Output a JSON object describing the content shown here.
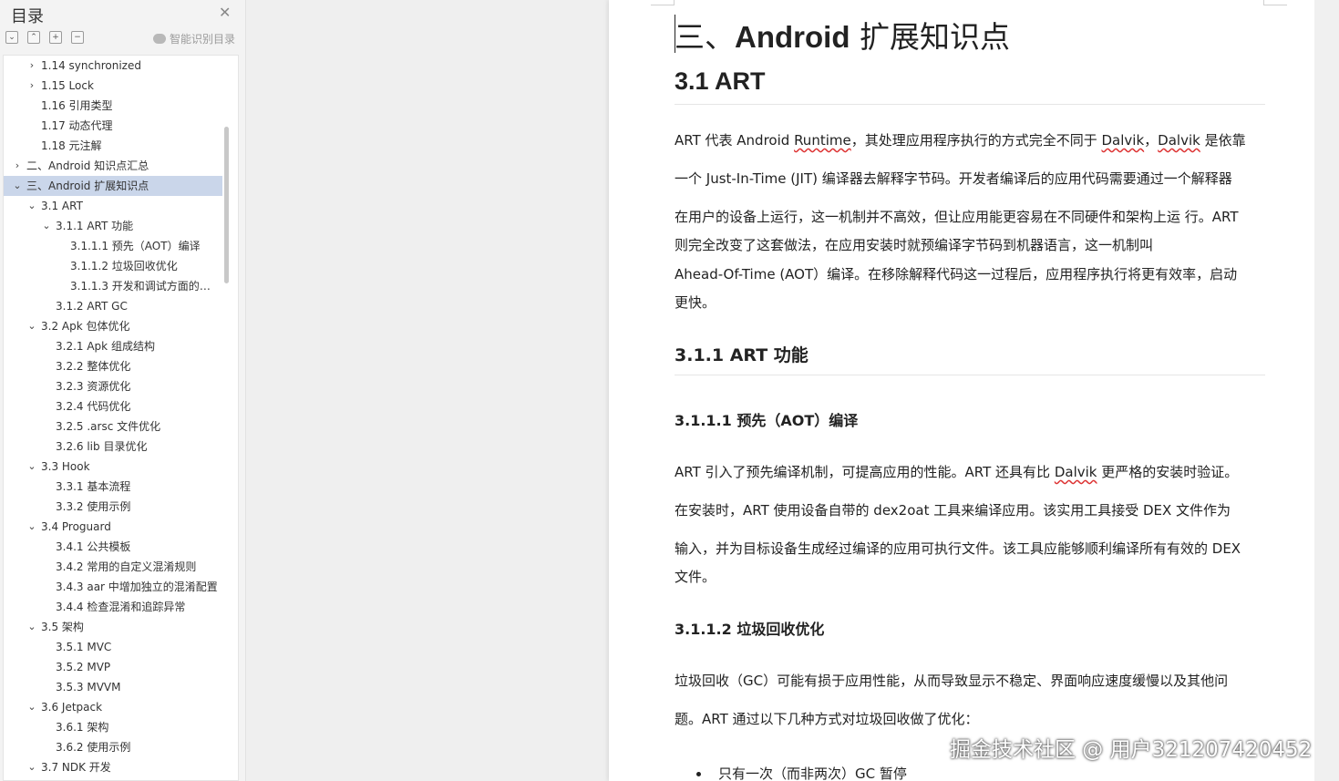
{
  "sidebar": {
    "title": "目录",
    "close_icon": "✕",
    "tools": [
      "⌄",
      "⌃",
      "+",
      "−"
    ],
    "smart_label": "智能识别目录",
    "toc": [
      {
        "label": "1.14 synchronized",
        "chev": "›"
      },
      {
        "label": "1.15 Lock",
        "chev": "›"
      },
      {
        "label": "1.16 引用类型",
        "chev": ""
      },
      {
        "label": "1.17 动态代理",
        "chev": ""
      },
      {
        "label": "1.18 元注解",
        "chev": ""
      },
      {
        "label": "二、Android 知识点汇总",
        "chev": "›"
      },
      {
        "label": "三、Android 扩展知识点",
        "chev": "⌄"
      },
      {
        "label": "3.1 ART",
        "chev": "⌄"
      },
      {
        "label": "3.1.1 ART 功能",
        "chev": "⌄"
      },
      {
        "label": "3.1.1.1 预先（AOT）编译",
        "chev": ""
      },
      {
        "label": "3.1.1.2 垃圾回收优化",
        "chev": ""
      },
      {
        "label": "3.1.1.3 开发和调试方面的优化",
        "chev": ""
      },
      {
        "label": "3.1.2 ART GC",
        "chev": ""
      },
      {
        "label": "3.2 Apk 包体优化",
        "chev": "⌄"
      },
      {
        "label": "3.2.1 Apk 组成结构",
        "chev": ""
      },
      {
        "label": "3.2.2 整体优化",
        "chev": ""
      },
      {
        "label": "3.2.3 资源优化",
        "chev": ""
      },
      {
        "label": "3.2.4 代码优化",
        "chev": ""
      },
      {
        "label": "3.2.5 .arsc 文件优化",
        "chev": ""
      },
      {
        "label": "3.2.6 lib 目录优化",
        "chev": ""
      },
      {
        "label": "3.3 Hook",
        "chev": "⌄"
      },
      {
        "label": "3.3.1 基本流程",
        "chev": ""
      },
      {
        "label": "3.3.2 使用示例",
        "chev": ""
      },
      {
        "label": "3.4 Proguard",
        "chev": "⌄"
      },
      {
        "label": "3.4.1 公共模板",
        "chev": ""
      },
      {
        "label": "3.4.2 常用的自定义混淆规则",
        "chev": ""
      },
      {
        "label": "3.4.3 aar 中增加独立的混淆配置",
        "chev": ""
      },
      {
        "label": "3.4.4 检查混淆和追踪异常",
        "chev": ""
      },
      {
        "label": "3.5 架构",
        "chev": "⌄"
      },
      {
        "label": "3.5.1 MVC",
        "chev": ""
      },
      {
        "label": "3.5.2 MVP",
        "chev": ""
      },
      {
        "label": "3.5.3 MVVM",
        "chev": ""
      },
      {
        "label": "3.6 Jetpack",
        "chev": "⌄"
      },
      {
        "label": "3.6.1 架构",
        "chev": ""
      },
      {
        "label": "3.6.2 使用示例",
        "chev": ""
      },
      {
        "label": "3.7 NDK 开发",
        "chev": "⌄"
      }
    ]
  },
  "document": {
    "h1_prefix": "三、",
    "h1_bold": "Android",
    "h1_suffix": " 扩展知识点",
    "h2": "3.1 ART",
    "p1_lines": [
      "ART 代表 Android Runtime，其处理应用程序执行的方式完全不同于 Dalvik，Dalvik 是依靠",
      "一个 Just-In-Time (JIT) 编译器去解释字节码。开发者编译后的应用代码需要通过一个解释器",
      "在用户的设备上运行，这一机制并不高效，但让应用能更容易在不同硬件和架构上运 行。ART",
      "则完全改变了这套做法，在应用安装时就预编译字节码到机器语言，这一机制叫",
      "Ahead-Of-Time (AOT）编译。在移除解释代码这一过程后，应用程序执行将更有效率，启动",
      "更快。"
    ],
    "h3": "3.1.1 ART 功能",
    "h4_1": "3.1.1.1 预先（AOT）编译",
    "p2_lines": [
      "ART 引入了预先编译机制，可提高应用的性能。ART 还具有比 Dalvik 更严格的安装时验证。",
      "在安装时，ART 使用设备自带的 dex2oat 工具来编译应用。该实用工具接受 DEX 文件作为",
      "输入，并为目标设备生成经过编译的应用可执行文件。该工具应能够顺利编译所有有效的 DEX",
      "文件。"
    ],
    "h4_2": "3.1.1.2 垃圾回收优化",
    "p3_lines": [
      "垃圾回收（GC）可能有损于应用性能，从而导致显示不稳定、界面响应速度缓慢以及其他问",
      "题。ART 通过以下几种方式对垃圾回收做了优化："
    ],
    "bullet1": "只有一次（而非两次）GC 暂停"
  },
  "watermark": "掘金技术社区 @ 用户321207420452"
}
